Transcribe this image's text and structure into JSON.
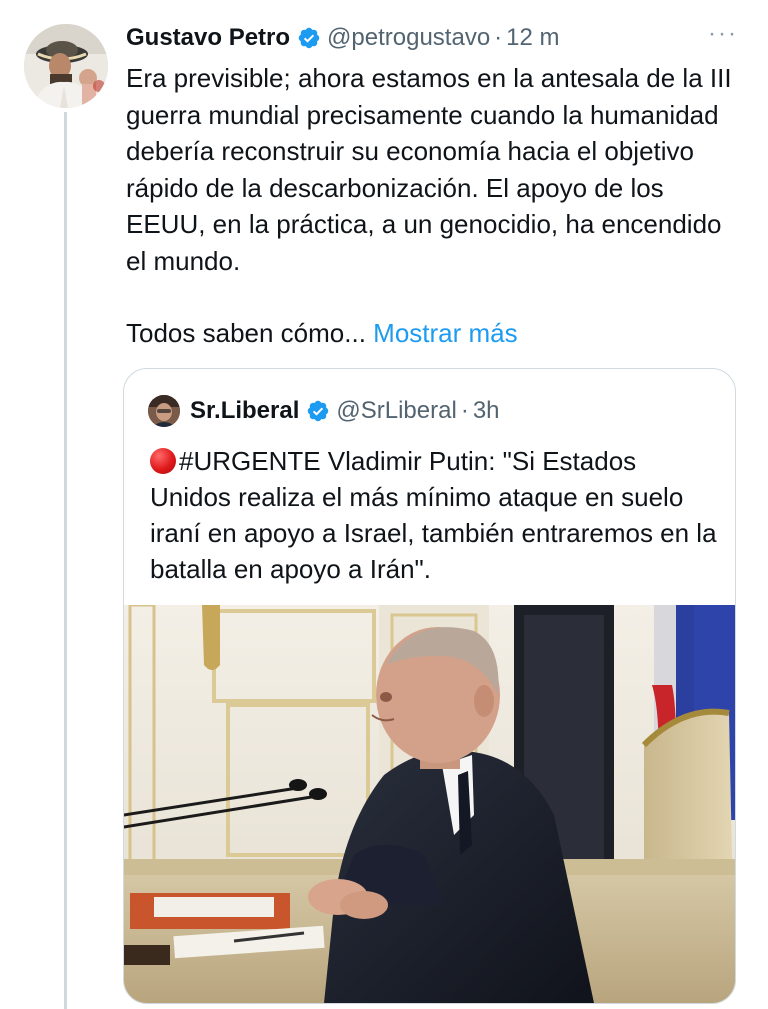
{
  "tweet": {
    "author": {
      "display_name": "Gustavo Petro",
      "handle": "@petrogustavo",
      "verified": true,
      "avatar_icon": "profile-photo"
    },
    "separator": "·",
    "time": "12 m",
    "more_icon": "ellipsis-icon",
    "more_label": "···",
    "text": "Era previsible; ahora estamos en la antesala de la III guerra mundial precisamente cuando la humanidad debería reconstruir su economía hacia el objetivo rápido de la descarbonización. El apoyo de los EEUU, en la práctica, a un genocidio, ha encendido el mundo.",
    "truncated_text": "Todos saben cómo...",
    "show_more": "Mostrar más"
  },
  "quote": {
    "author": {
      "display_name": "Sr.Liberal",
      "handle": "@SrLiberal",
      "verified": true
    },
    "separator": "·",
    "time": "3h",
    "emoji": "red-circle",
    "text": "#URGENTE Vladimir Putin:  \"Si Estados Unidos realiza el más mínimo ataque en suelo iraní en apoyo a Israel, también entraremos en la batalla en apoyo a Irán\".",
    "image": "photo-man-at-desk-with-microphones"
  },
  "colors": {
    "verified": "#1d9bf0",
    "link": "#1d9bf0",
    "muted": "#536471",
    "border": "#cfd9de",
    "text": "#0f1419"
  }
}
